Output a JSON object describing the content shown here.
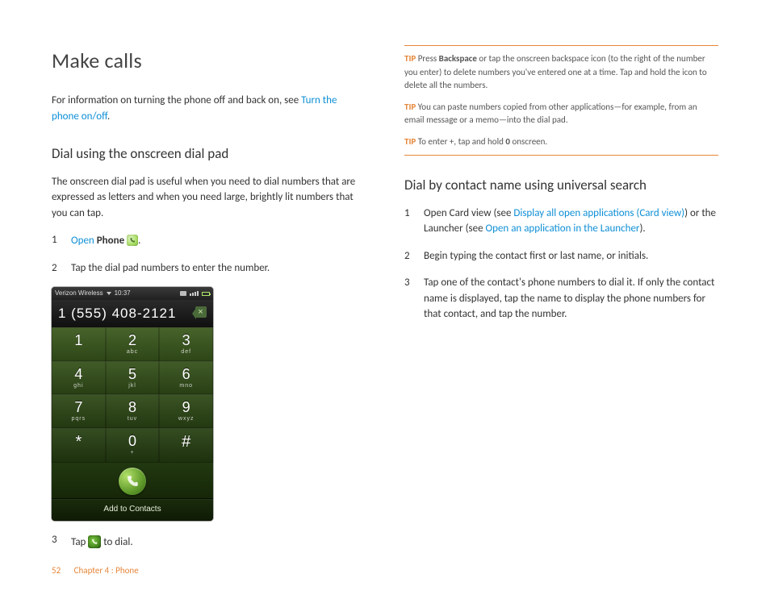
{
  "title": "Make calls",
  "intro_prefix": "For information on turning the phone off and back on, see ",
  "intro_link": "Turn the phone on/off",
  "intro_suffix": ".",
  "sec1": {
    "heading": "Dial using the onscreen dial pad",
    "para": "The onscreen dial pad is useful when you need to dial numbers that are expressed as letters and when you need large, brightly lit numbers that you can tap.",
    "step1_link": "Open",
    "step1_bold": "Phone",
    "step1_after": ".",
    "step2": "Tap the dial pad numbers to enter the number.",
    "step3_before": "Tap ",
    "step3_after": " to dial."
  },
  "phone": {
    "carrier": "Verizon Wireless",
    "time": "10:37",
    "display": "1 (555) 408-2121",
    "keys": [
      {
        "d": "1",
        "l": ""
      },
      {
        "d": "2",
        "l": "abc"
      },
      {
        "d": "3",
        "l": "def"
      },
      {
        "d": "4",
        "l": "ghi"
      },
      {
        "d": "5",
        "l": "jkl"
      },
      {
        "d": "6",
        "l": "mno"
      },
      {
        "d": "7",
        "l": "pqrs"
      },
      {
        "d": "8",
        "l": "tuv"
      },
      {
        "d": "9",
        "l": "wxyz"
      },
      {
        "d": "*",
        "l": ""
      },
      {
        "d": "0",
        "l": "+"
      },
      {
        "d": "#",
        "l": ""
      }
    ],
    "add": "Add to Contacts"
  },
  "tips": {
    "label": "TIP",
    "t1a": "Press ",
    "t1b": "Backspace",
    "t1c": " or tap the onscreen backspace icon (to the right of the number you enter) to delete numbers you've entered one at a time. Tap and hold the icon to delete all the numbers.",
    "t2": "You can paste numbers copied from other applications—for example, from an email message or a memo—into the dial pad.",
    "t3a": "To enter +, tap and hold ",
    "t3b": "0",
    "t3c": " onscreen."
  },
  "sec2": {
    "heading": "Dial by contact name using universal search",
    "s1a": "Open Card view (see ",
    "s1link1": "Display all open applications (Card view)",
    "s1b": ") or the Launcher (see ",
    "s1link2": "Open an application in the Launcher",
    "s1c": ").",
    "s2": "Begin typing the contact first or last name, or initials.",
    "s3": "Tap one of the contact's phone numbers to dial it. If only the contact name is displayed, tap the name to display the phone numbers for that contact, and tap the number."
  },
  "footer": {
    "page": "52",
    "chapter": "Chapter 4 : Phone"
  }
}
